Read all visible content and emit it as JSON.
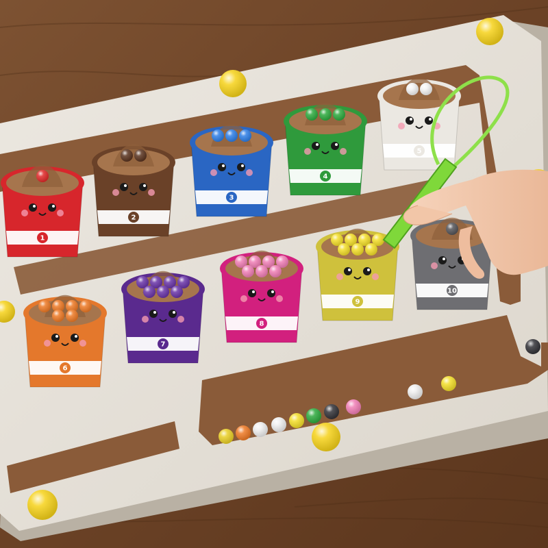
{
  "scene": {
    "subject": "wooden magnetic color sorting maze board",
    "colors": {
      "table": "#74492b",
      "table_dark": "#4e2d18",
      "board": "#e6e2da",
      "board_edge": "#bdb6aa",
      "groove": "#8a5b39",
      "groove_light": "#a3704a",
      "wand": "#8ee04a",
      "skin": "#f3c9ad",
      "mount_ball": "#f6d21a"
    }
  },
  "cups": [
    {
      "number": "1",
      "color": "#d7262c",
      "ball_color": "#e02a2a",
      "ball_count": 1
    },
    {
      "number": "2",
      "color": "#6a4128",
      "ball_color": "#5a3420",
      "ball_count": 2
    },
    {
      "number": "3",
      "color": "#2a66c3",
      "ball_color": "#2f7fe6",
      "ball_count": 3
    },
    {
      "number": "4",
      "color": "#2f9a3c",
      "ball_color": "#2eaa3f",
      "ball_count": 3
    },
    {
      "number": "5",
      "color": "#ebe8e2",
      "ball_color": "#f2f2f2",
      "ball_count": 2
    },
    {
      "number": "6",
      "color": "#e4782c",
      "ball_color": "#ee7a26",
      "ball_count": 6
    },
    {
      "number": "7",
      "color": "#5a2a8e",
      "ball_color": "#6a35a8",
      "ball_count": 7
    },
    {
      "number": "8",
      "color": "#d2207e",
      "ball_color": "#f07fb6",
      "ball_count": 7
    },
    {
      "number": "9",
      "color": "#cfc13c",
      "ball_color": "#f3de2a",
      "ball_count": 7
    },
    {
      "number": "10",
      "color": "#6e6e72",
      "ball_color": "#555559",
      "ball_count": 1
    }
  ],
  "loose_balls": [
    "#e9cf26",
    "#ee7a26",
    "#eeeeee",
    "#eeeeee",
    "#f3de2a",
    "#2eaa3f",
    "#333338",
    "#f07fb6",
    "#eeeeee",
    "#f3de2a",
    "#333338"
  ]
}
